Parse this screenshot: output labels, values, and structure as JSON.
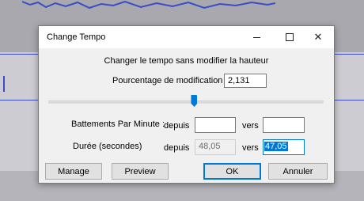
{
  "dialog": {
    "title": "Change Tempo",
    "header": "Changer le tempo sans modifier la hauteur",
    "percent": {
      "label": "Pourcentage de modification :",
      "value": "2,131"
    },
    "slider": {
      "position_fraction": 0.53
    },
    "bpm": {
      "label": "Battements Par Minute :",
      "from_label": "depuis",
      "from_value": "",
      "to_label": "vers",
      "to_value": ""
    },
    "duration": {
      "label": "Durée (secondes)",
      "from_label": "depuis",
      "from_value": "48,05",
      "to_label": "vers",
      "to_value": "47,05"
    },
    "buttons": {
      "manage": "Manage",
      "preview": "Preview",
      "ok": "OK",
      "cancel": "Annuler"
    },
    "titlebar": {
      "minimize_glyph": "–",
      "close_glyph": "✕"
    }
  },
  "colors": {
    "accent": "#0078d7",
    "track_line": "#3a4cc8"
  },
  "icons": [
    "minimize-icon",
    "maximize-icon",
    "close-icon",
    "slider-thumb"
  ]
}
